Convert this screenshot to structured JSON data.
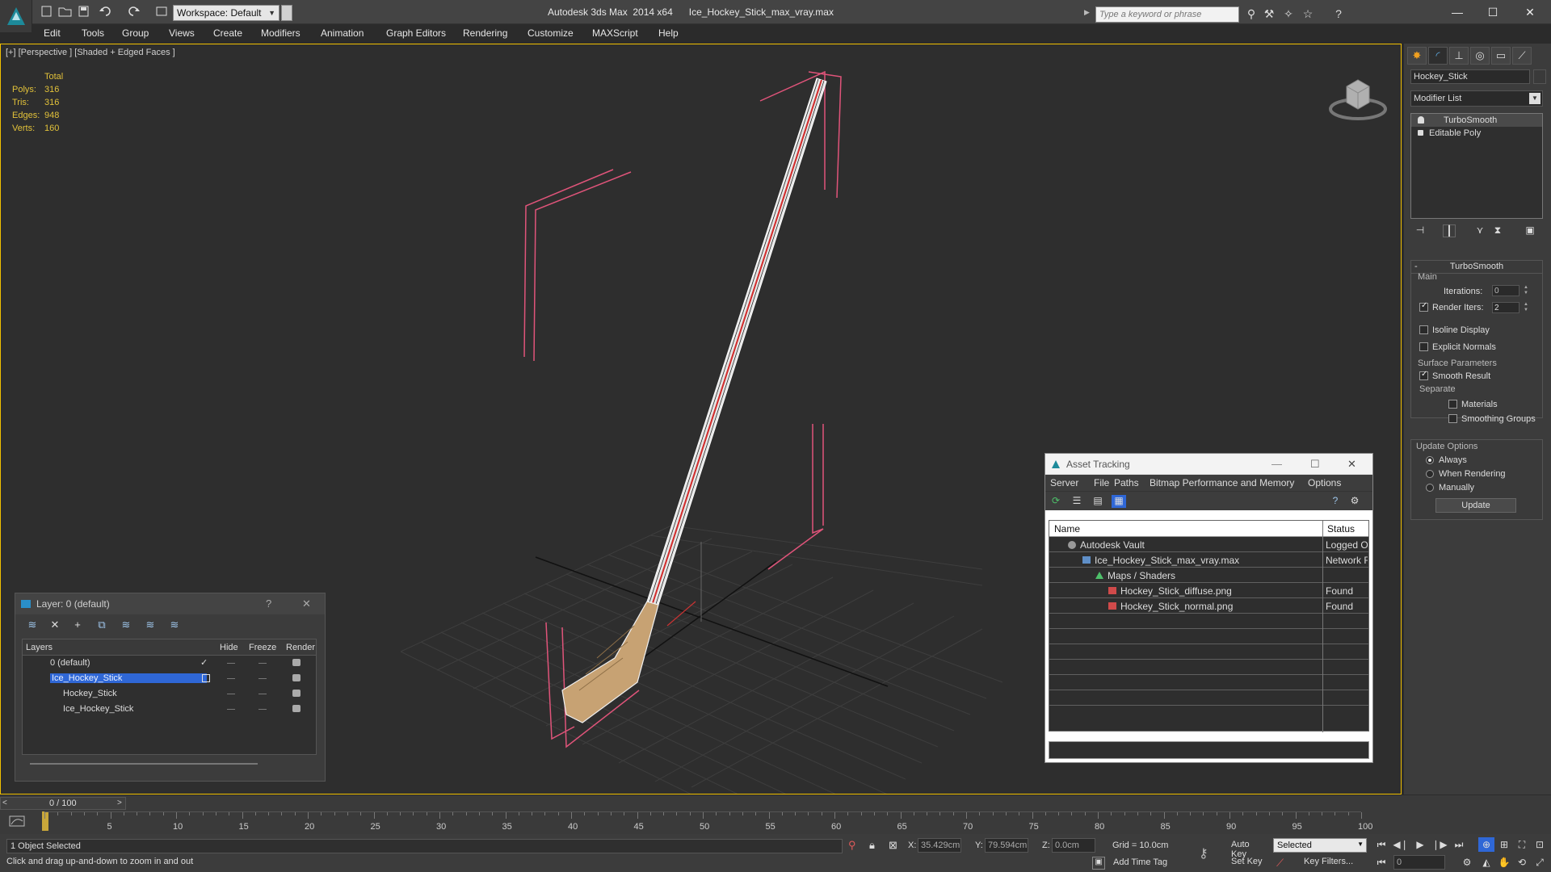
{
  "window": {
    "title": "Autodesk 3ds Max  2014 x64      Ice_Hockey_Stick_max_vray.max",
    "workspace_label": "Workspace: Default",
    "search_placeholder": "Type a keyword or phrase"
  },
  "menu": [
    "Edit",
    "Tools",
    "Group",
    "Views",
    "Create",
    "Modifiers",
    "Animation",
    "Graph Editors",
    "Rendering",
    "Customize",
    "MAXScript",
    "Help"
  ],
  "viewport": {
    "label": "[+] [Perspective ] [Shaded + Edged Faces ]",
    "stats": {
      "header": "Total",
      "rows": [
        {
          "k": "Polys:",
          "v": "316"
        },
        {
          "k": "Tris:",
          "v": "316"
        },
        {
          "k": "Edges:",
          "v": "948"
        },
        {
          "k": "Verts:",
          "v": "160"
        }
      ]
    }
  },
  "layer_window": {
    "title": "Layer: 0 (default)",
    "help": "?",
    "columns": [
      "Layers",
      "Hide",
      "Freeze",
      "Render"
    ],
    "rows": [
      {
        "name": "0 (default)"
      },
      {
        "name": "Ice_Hockey_Stick"
      },
      {
        "name": "Hockey_Stick"
      },
      {
        "name": "Ice_Hockey_Stick"
      }
    ]
  },
  "asset_window": {
    "title": "Asset Tracking",
    "menu": [
      "Server",
      "File",
      "Paths",
      "Bitmap Performance and Memory",
      "Options"
    ],
    "columns": [
      "Name",
      "Status"
    ],
    "rows": [
      {
        "name": "Autodesk Vault",
        "status": "Logged O"
      },
      {
        "name": "Ice_Hockey_Stick_max_vray.max",
        "status": "Network F"
      },
      {
        "name": "Maps / Shaders",
        "status": ""
      },
      {
        "name": "Hockey_Stick_diffuse.png",
        "status": "Found"
      },
      {
        "name": "Hockey_Stick_normal.png",
        "status": "Found"
      }
    ]
  },
  "command_panel": {
    "object_name": "Hockey_Stick",
    "modifier_list": "Modifier List",
    "stack": [
      "TurboSmooth",
      "Editable Poly"
    ],
    "rollout_title": "TurboSmooth",
    "main_label": "Main",
    "iterations_label": "Iterations:",
    "iterations_value": "0",
    "render_iters_label": "Render Iters:",
    "render_iters_value": "2",
    "isoline_label": "Isoline Display",
    "explicit_normals_label": "Explicit Normals",
    "surface_params_label": "Surface Parameters",
    "smooth_result_label": "Smooth Result",
    "separate_label": "Separate",
    "materials_label": "Materials",
    "smoothing_groups_label": "Smoothing Groups",
    "update_options_label": "Update Options",
    "always_label": "Always",
    "when_rendering_label": "When Rendering",
    "manually_label": "Manually",
    "update_button": "Update"
  },
  "timeline": {
    "slider_label": "0 / 100",
    "left": "<",
    "right": ">",
    "ticks": [
      "5",
      "10",
      "15",
      "20",
      "25",
      "30",
      "35",
      "40",
      "45",
      "50",
      "55",
      "60",
      "65",
      "70",
      "75",
      "80",
      "85",
      "90",
      "95",
      "100"
    ]
  },
  "status": {
    "selection": "1 Object Selected",
    "prompt": "Click and drag up-and-down to zoom in and out",
    "x_label": "X:",
    "x_value": "35.429cm",
    "y_label": "Y:",
    "y_value": "79.594cm",
    "z_label": "Z:",
    "z_value": "0.0cm",
    "grid": "Grid = 10.0cm",
    "add_time_tag": "Add Time Tag",
    "auto_key": "Auto Key",
    "set_key": "Set Key",
    "selected_dd": "Selected",
    "key_filters": "Key Filters...",
    "frame": "0"
  },
  "colors": {
    "accent_yellow": "#f1c000",
    "stats_text": "#e2c23a",
    "selection_blue": "#2f67d6",
    "bbox_pink": "#e0547a"
  }
}
